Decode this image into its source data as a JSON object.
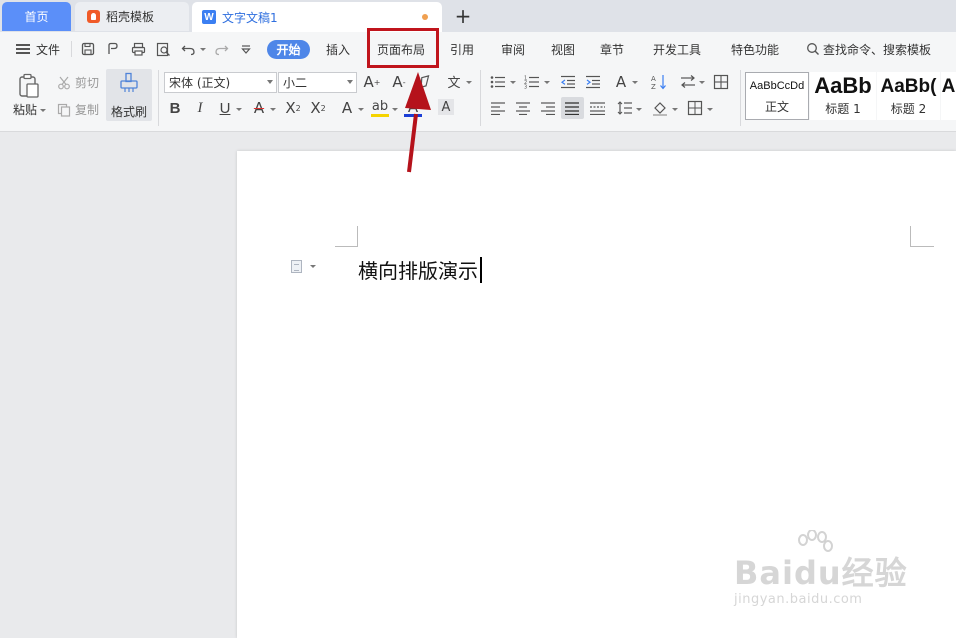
{
  "tabs": {
    "home": "首页",
    "docer": "稻壳模板",
    "document": "文字文稿1",
    "document_icon": "W",
    "add": "+"
  },
  "menu": {
    "file": "文件",
    "items": [
      "开始",
      "插入",
      "页面布局",
      "引用",
      "审阅",
      "视图",
      "章节",
      "开发工具",
      "特色功能"
    ],
    "search": "查找命令、搜索模板",
    "highlighted": "页面布局"
  },
  "ribbon": {
    "paste": "粘贴",
    "cut": "剪切",
    "copy": "复制",
    "format_painter": "格式刷",
    "font_name": "宋体 (正文)",
    "font_size": "小二",
    "styles": [
      {
        "preview": "AaBbCcDd",
        "name": "正文"
      },
      {
        "preview": "AaBb",
        "name": "标题 1"
      },
      {
        "preview": "AaBb(",
        "name": "标题 2"
      },
      {
        "preview": "A",
        "name": ""
      }
    ]
  },
  "document": {
    "text": "横向排版演示"
  },
  "watermark": {
    "brand": "Baidu经验",
    "url": "jingyan.baidu.com"
  },
  "colors": {
    "accent": "#4e86e8",
    "highlight": "#c0141c",
    "home_tab": "#5b8ff9"
  }
}
